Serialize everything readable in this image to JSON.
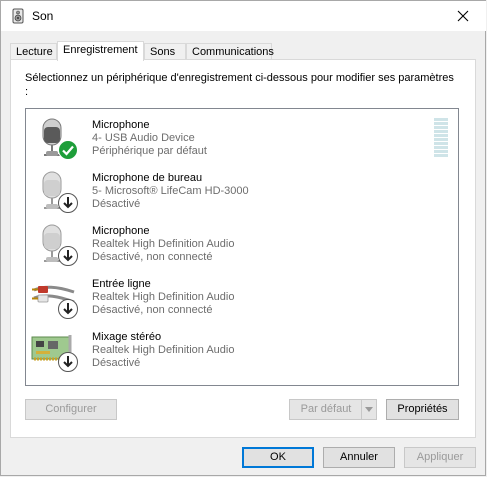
{
  "window": {
    "title": "Son"
  },
  "tabs": [
    {
      "label": "Lecture"
    },
    {
      "label": "Enregistrement"
    },
    {
      "label": "Sons"
    },
    {
      "label": "Communications"
    }
  ],
  "instructions": "Sélectionnez un périphérique d'enregistrement ci-dessous pour modifier ses paramètres :",
  "devices": [
    {
      "name": "Microphone",
      "line2": "4- USB Audio Device",
      "line3": "Périphérique par défaut",
      "icon": "microphone-icon",
      "status_icon": "check-icon"
    },
    {
      "name": "Microphone de bureau",
      "line2": "5- Microsoft® LifeCam HD-3000",
      "line3": "Désactivé",
      "icon": "microphone-icon",
      "status_icon": "down-arrow-icon"
    },
    {
      "name": "Microphone",
      "line2": "Realtek High Definition Audio",
      "line3": "Désactivé, non connecté",
      "icon": "microphone-icon",
      "status_icon": "down-arrow-icon"
    },
    {
      "name": "Entrée ligne",
      "line2": "Realtek High Definition Audio",
      "line3": "Désactivé, non connecté",
      "icon": "line-in-cable-icon",
      "status_icon": "down-arrow-icon"
    },
    {
      "name": "Mixage stéréo",
      "line2": "Realtek High Definition Audio",
      "line3": "Désactivé",
      "icon": "sound-card-icon",
      "status_icon": "down-arrow-icon"
    }
  ],
  "buttons": {
    "configure": "Configurer",
    "set_default": "Par défaut",
    "properties": "Propriétés",
    "ok": "OK",
    "cancel": "Annuler",
    "apply": "Appliquer"
  },
  "colors": {
    "accent": "#0078d7",
    "check": "#1e9e3a"
  }
}
